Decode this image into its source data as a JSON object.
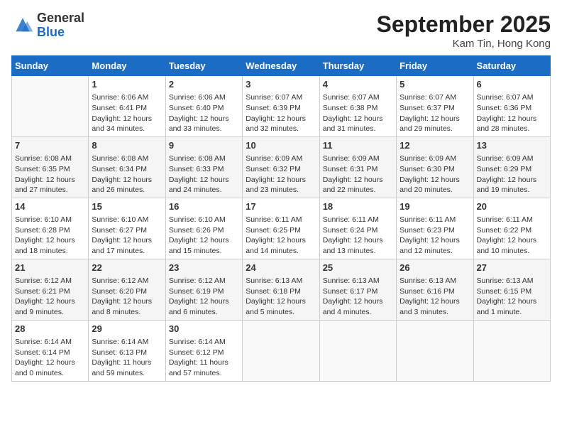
{
  "header": {
    "logo_general": "General",
    "logo_blue": "Blue",
    "month": "September 2025",
    "location": "Kam Tin, Hong Kong"
  },
  "days_of_week": [
    "Sunday",
    "Monday",
    "Tuesday",
    "Wednesday",
    "Thursday",
    "Friday",
    "Saturday"
  ],
  "weeks": [
    [
      {
        "num": "",
        "info": ""
      },
      {
        "num": "1",
        "info": "Sunrise: 6:06 AM\nSunset: 6:41 PM\nDaylight: 12 hours\nand 34 minutes."
      },
      {
        "num": "2",
        "info": "Sunrise: 6:06 AM\nSunset: 6:40 PM\nDaylight: 12 hours\nand 33 minutes."
      },
      {
        "num": "3",
        "info": "Sunrise: 6:07 AM\nSunset: 6:39 PM\nDaylight: 12 hours\nand 32 minutes."
      },
      {
        "num": "4",
        "info": "Sunrise: 6:07 AM\nSunset: 6:38 PM\nDaylight: 12 hours\nand 31 minutes."
      },
      {
        "num": "5",
        "info": "Sunrise: 6:07 AM\nSunset: 6:37 PM\nDaylight: 12 hours\nand 29 minutes."
      },
      {
        "num": "6",
        "info": "Sunrise: 6:07 AM\nSunset: 6:36 PM\nDaylight: 12 hours\nand 28 minutes."
      }
    ],
    [
      {
        "num": "7",
        "info": "Sunrise: 6:08 AM\nSunset: 6:35 PM\nDaylight: 12 hours\nand 27 minutes."
      },
      {
        "num": "8",
        "info": "Sunrise: 6:08 AM\nSunset: 6:34 PM\nDaylight: 12 hours\nand 26 minutes."
      },
      {
        "num": "9",
        "info": "Sunrise: 6:08 AM\nSunset: 6:33 PM\nDaylight: 12 hours\nand 24 minutes."
      },
      {
        "num": "10",
        "info": "Sunrise: 6:09 AM\nSunset: 6:32 PM\nDaylight: 12 hours\nand 23 minutes."
      },
      {
        "num": "11",
        "info": "Sunrise: 6:09 AM\nSunset: 6:31 PM\nDaylight: 12 hours\nand 22 minutes."
      },
      {
        "num": "12",
        "info": "Sunrise: 6:09 AM\nSunset: 6:30 PM\nDaylight: 12 hours\nand 20 minutes."
      },
      {
        "num": "13",
        "info": "Sunrise: 6:09 AM\nSunset: 6:29 PM\nDaylight: 12 hours\nand 19 minutes."
      }
    ],
    [
      {
        "num": "14",
        "info": "Sunrise: 6:10 AM\nSunset: 6:28 PM\nDaylight: 12 hours\nand 18 minutes."
      },
      {
        "num": "15",
        "info": "Sunrise: 6:10 AM\nSunset: 6:27 PM\nDaylight: 12 hours\nand 17 minutes."
      },
      {
        "num": "16",
        "info": "Sunrise: 6:10 AM\nSunset: 6:26 PM\nDaylight: 12 hours\nand 15 minutes."
      },
      {
        "num": "17",
        "info": "Sunrise: 6:11 AM\nSunset: 6:25 PM\nDaylight: 12 hours\nand 14 minutes."
      },
      {
        "num": "18",
        "info": "Sunrise: 6:11 AM\nSunset: 6:24 PM\nDaylight: 12 hours\nand 13 minutes."
      },
      {
        "num": "19",
        "info": "Sunrise: 6:11 AM\nSunset: 6:23 PM\nDaylight: 12 hours\nand 12 minutes."
      },
      {
        "num": "20",
        "info": "Sunrise: 6:11 AM\nSunset: 6:22 PM\nDaylight: 12 hours\nand 10 minutes."
      }
    ],
    [
      {
        "num": "21",
        "info": "Sunrise: 6:12 AM\nSunset: 6:21 PM\nDaylight: 12 hours\nand 9 minutes."
      },
      {
        "num": "22",
        "info": "Sunrise: 6:12 AM\nSunset: 6:20 PM\nDaylight: 12 hours\nand 8 minutes."
      },
      {
        "num": "23",
        "info": "Sunrise: 6:12 AM\nSunset: 6:19 PM\nDaylight: 12 hours\nand 6 minutes."
      },
      {
        "num": "24",
        "info": "Sunrise: 6:13 AM\nSunset: 6:18 PM\nDaylight: 12 hours\nand 5 minutes."
      },
      {
        "num": "25",
        "info": "Sunrise: 6:13 AM\nSunset: 6:17 PM\nDaylight: 12 hours\nand 4 minutes."
      },
      {
        "num": "26",
        "info": "Sunrise: 6:13 AM\nSunset: 6:16 PM\nDaylight: 12 hours\nand 3 minutes."
      },
      {
        "num": "27",
        "info": "Sunrise: 6:13 AM\nSunset: 6:15 PM\nDaylight: 12 hours\nand 1 minute."
      }
    ],
    [
      {
        "num": "28",
        "info": "Sunrise: 6:14 AM\nSunset: 6:14 PM\nDaylight: 12 hours\nand 0 minutes."
      },
      {
        "num": "29",
        "info": "Sunrise: 6:14 AM\nSunset: 6:13 PM\nDaylight: 11 hours\nand 59 minutes."
      },
      {
        "num": "30",
        "info": "Sunrise: 6:14 AM\nSunset: 6:12 PM\nDaylight: 11 hours\nand 57 minutes."
      },
      {
        "num": "",
        "info": ""
      },
      {
        "num": "",
        "info": ""
      },
      {
        "num": "",
        "info": ""
      },
      {
        "num": "",
        "info": ""
      }
    ]
  ]
}
